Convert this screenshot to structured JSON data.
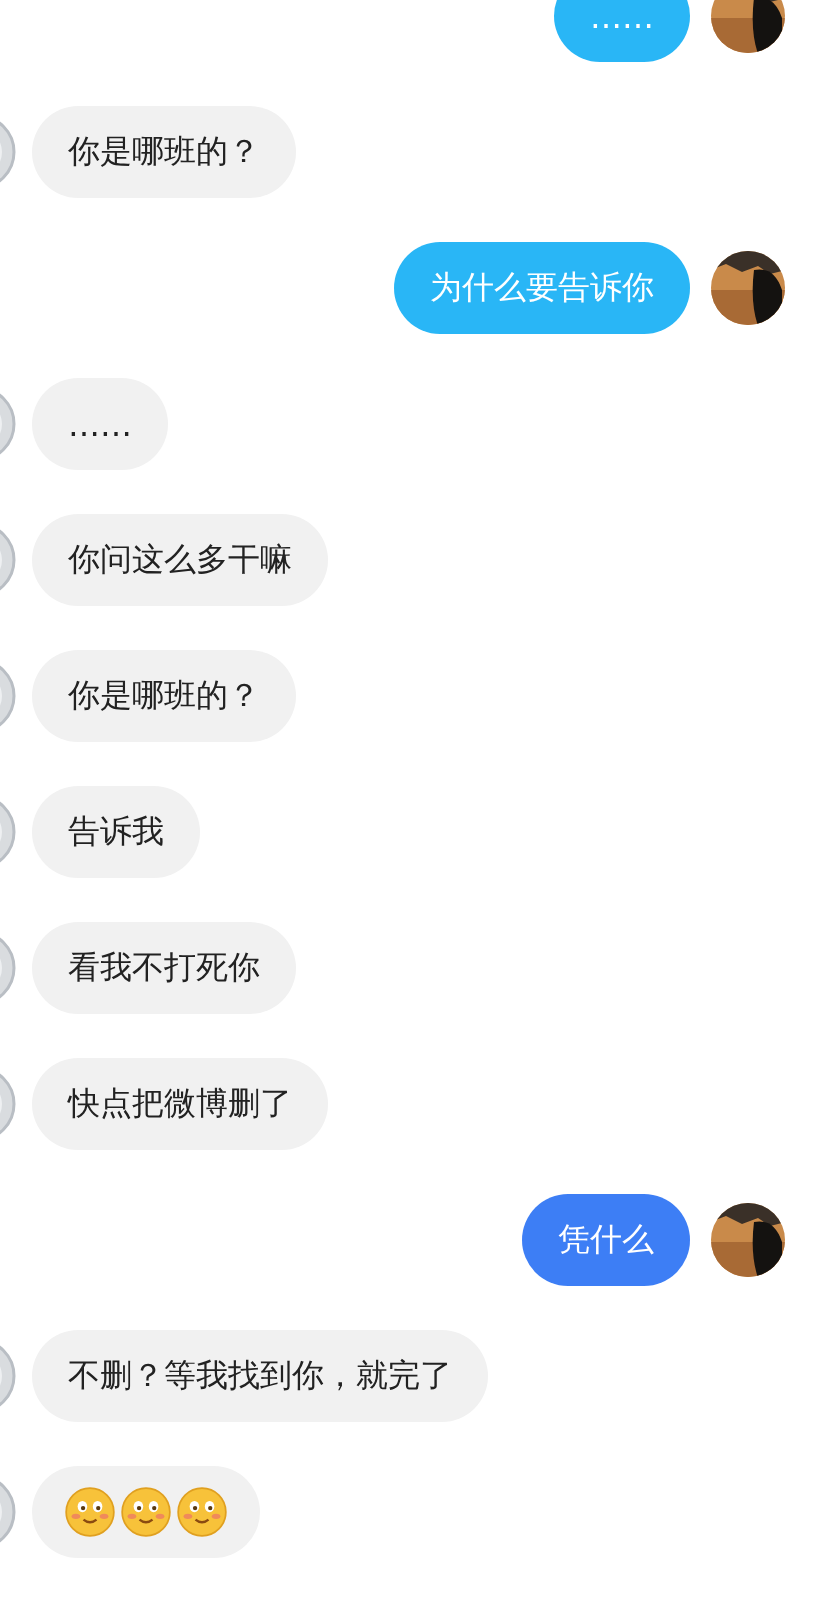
{
  "messages": [
    {
      "outgoing": true,
      "kind": "text",
      "text": "……",
      "color": "#29b6f6"
    },
    {
      "outgoing": false,
      "kind": "text",
      "text": "你是哪班的？"
    },
    {
      "outgoing": true,
      "kind": "text",
      "text": "为什么要告诉你",
      "color": "#29b6f6"
    },
    {
      "outgoing": false,
      "kind": "text",
      "text": "……"
    },
    {
      "outgoing": false,
      "kind": "text",
      "text": "你问这么多干嘛"
    },
    {
      "outgoing": false,
      "kind": "text",
      "text": "你是哪班的？"
    },
    {
      "outgoing": false,
      "kind": "text",
      "text": "告诉我"
    },
    {
      "outgoing": false,
      "kind": "text",
      "text": "看我不打死你"
    },
    {
      "outgoing": false,
      "kind": "text",
      "text": "快点把微博删了"
    },
    {
      "outgoing": true,
      "kind": "text",
      "text": "凭什么",
      "color": "#3d7ef5"
    },
    {
      "outgoing": false,
      "kind": "text",
      "text": "不删？等我找到你，就完了"
    },
    {
      "outgoing": false,
      "kind": "emoji",
      "emojis": [
        {
          "kind": "smile"
        },
        {
          "kind": "smile"
        },
        {
          "kind": "smile"
        }
      ]
    }
  ]
}
